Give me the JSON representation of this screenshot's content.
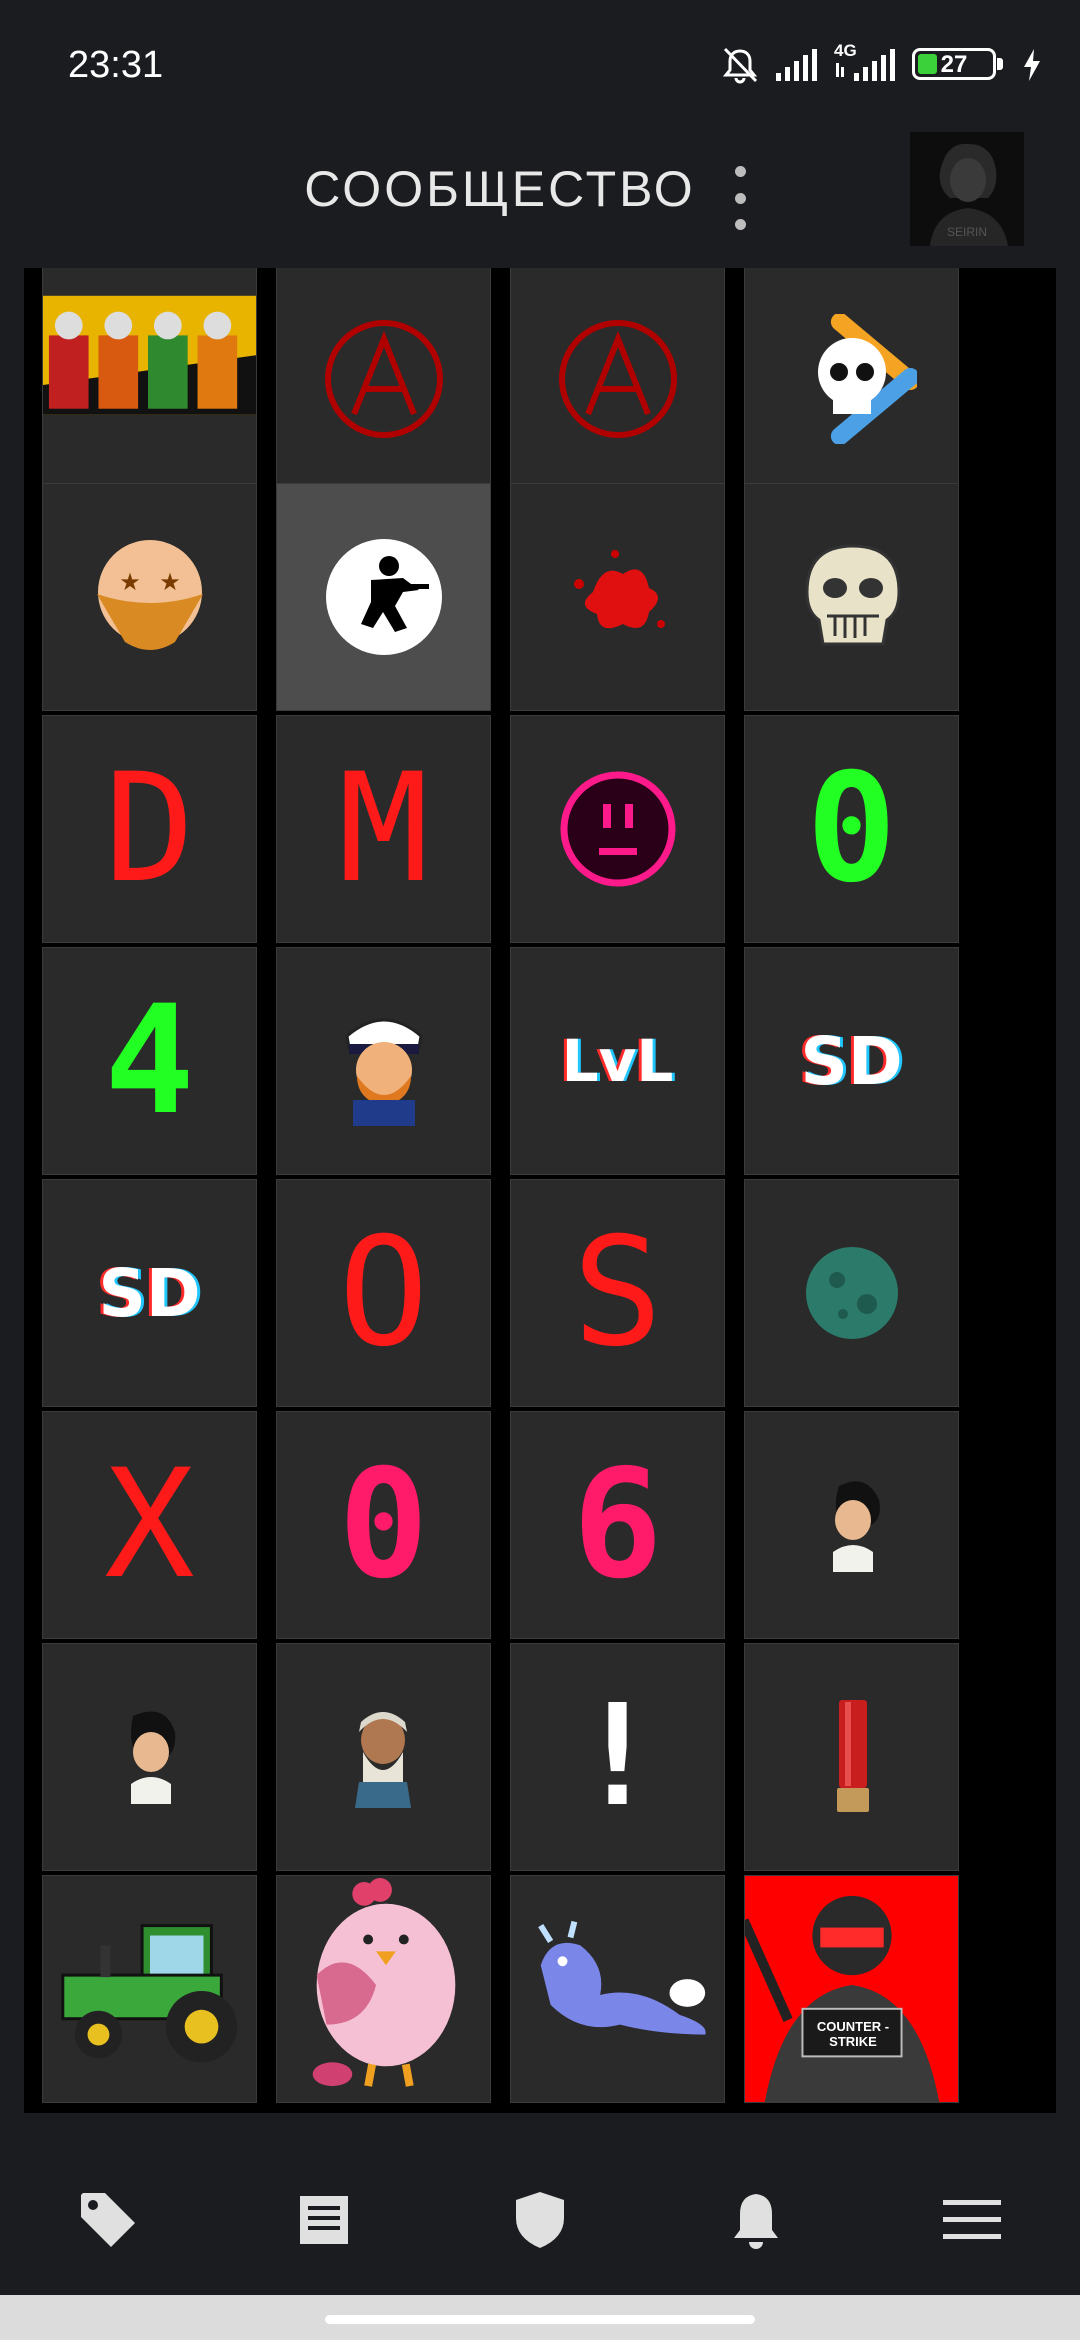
{
  "status_bar": {
    "time": "23:31",
    "network_label": "4G",
    "battery_percent": 27,
    "battery_label": "27",
    "icons": [
      "bell-off-icon",
      "signal-icon",
      "signal-4g-icon",
      "battery-icon",
      "charging-icon"
    ]
  },
  "header": {
    "title": "СООБЩЕСТВО",
    "menu_icon": "more-vertical-icon"
  },
  "badge_grid": {
    "columns": 4,
    "selected_index": 5,
    "items": [
      {
        "name": "payday-crew-badge"
      },
      {
        "name": "anarchy-badge"
      },
      {
        "name": "anarchy-badge"
      },
      {
        "name": "skull-crossbones-badge"
      },
      {
        "name": "bandit-emoji-badge"
      },
      {
        "name": "soldier-silhouette-badge"
      },
      {
        "name": "blood-splatter-badge"
      },
      {
        "name": "grinning-skull-badge"
      },
      {
        "name": "letter-d-badge",
        "text": "D"
      },
      {
        "name": "letter-m-badge",
        "text": "M"
      },
      {
        "name": "neon-smiley-badge"
      },
      {
        "name": "digit-0-badge",
        "text": "0"
      },
      {
        "name": "digit-4-badge",
        "text": "4"
      },
      {
        "name": "captain-badge"
      },
      {
        "name": "lvl-badge",
        "text": "LvL"
      },
      {
        "name": "sd-badge",
        "text": "SD"
      },
      {
        "name": "sd-badge",
        "text": "SD"
      },
      {
        "name": "letter-o-badge",
        "text": "O"
      },
      {
        "name": "letter-s-badge",
        "text": "S"
      },
      {
        "name": "green-planet-badge"
      },
      {
        "name": "letter-x-badge",
        "text": "X"
      },
      {
        "name": "digit-0-pink-badge",
        "text": "0"
      },
      {
        "name": "digit-6-badge",
        "text": "6"
      },
      {
        "name": "boy-profile-badge"
      },
      {
        "name": "boy-front-badge"
      },
      {
        "name": "old-man-badge"
      },
      {
        "name": "exclamation-badge",
        "text": "!"
      },
      {
        "name": "shotgun-shell-badge"
      },
      {
        "name": "tractor-badge"
      },
      {
        "name": "pink-chick-badge"
      },
      {
        "name": "blue-dragon-badge"
      },
      {
        "name": "counter-strike-badge",
        "text": "COUNTER - STRIKE"
      }
    ]
  },
  "bottom_nav": {
    "items": [
      {
        "icon": "tag-icon"
      },
      {
        "icon": "news-icon"
      },
      {
        "icon": "shield-icon"
      },
      {
        "icon": "bell-icon"
      },
      {
        "icon": "menu-icon"
      }
    ]
  }
}
